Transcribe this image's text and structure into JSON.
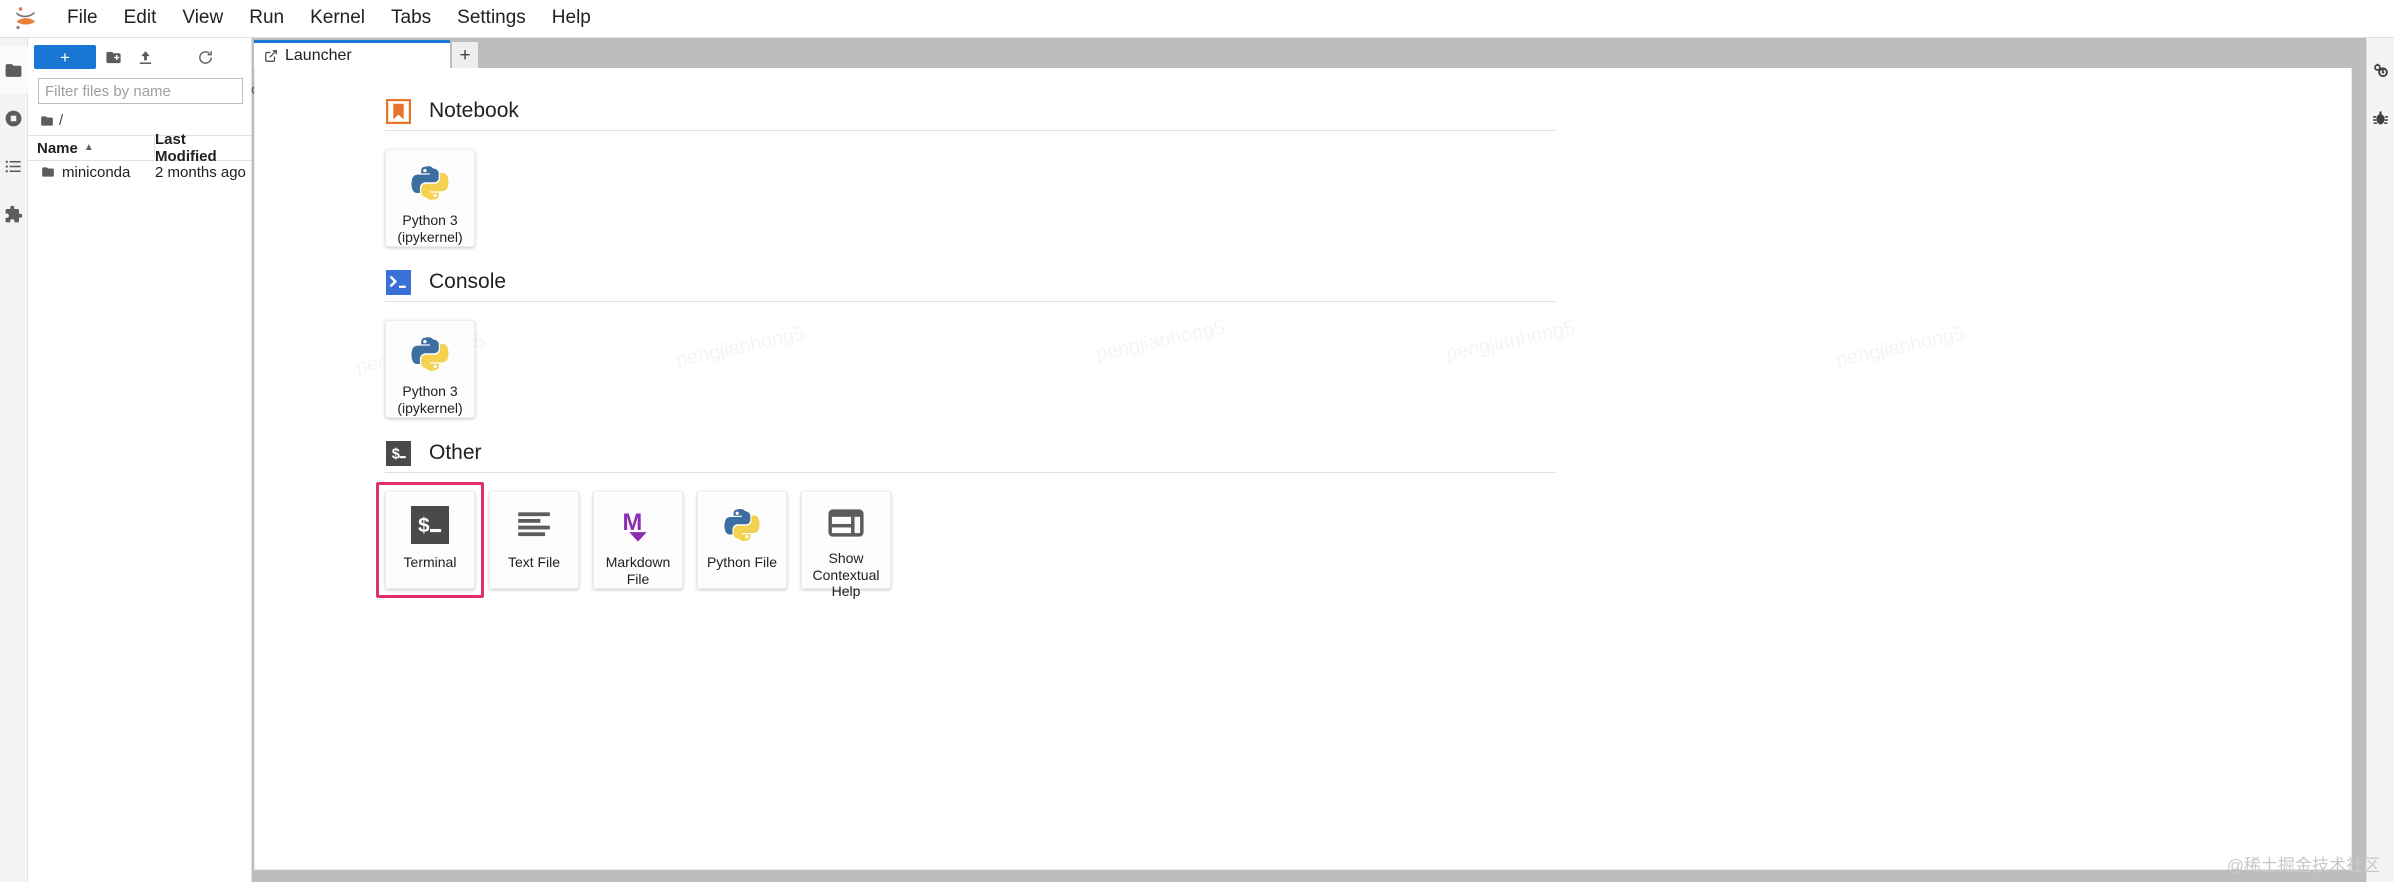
{
  "app": {
    "logo_icon": "jupyter-logo",
    "watermark": "@稀土掘金技术社区",
    "ghost_watermark": "pengjianhong5"
  },
  "menubar": {
    "items": [
      {
        "label": "File",
        "name": "menu-file"
      },
      {
        "label": "Edit",
        "name": "menu-edit"
      },
      {
        "label": "View",
        "name": "menu-view"
      },
      {
        "label": "Run",
        "name": "menu-run"
      },
      {
        "label": "Kernel",
        "name": "menu-kernel"
      },
      {
        "label": "Tabs",
        "name": "menu-tabs"
      },
      {
        "label": "Settings",
        "name": "menu-settings"
      },
      {
        "label": "Help",
        "name": "menu-help"
      }
    ]
  },
  "left_activity_bar": {
    "items": [
      {
        "name": "file-browser-icon",
        "icon": "folder-icon",
        "active": true
      },
      {
        "name": "running-sessions-icon",
        "icon": "stop-circle-icon",
        "active": false
      },
      {
        "name": "table-of-contents-icon",
        "icon": "list-icon",
        "active": false
      },
      {
        "name": "extension-manager-icon",
        "icon": "puzzle-icon",
        "active": false
      }
    ]
  },
  "right_activity_bar": {
    "items": [
      {
        "name": "property-inspector-icon",
        "icon": "gears-icon"
      },
      {
        "name": "debugger-icon",
        "icon": "bug-icon"
      }
    ]
  },
  "file_browser": {
    "toolbar": {
      "new_launcher_label": "+",
      "new_folder_icon": "new-folder-icon",
      "upload_icon": "upload-icon",
      "refresh_icon": "refresh-icon"
    },
    "filter": {
      "value": "",
      "placeholder": "Filter files by name",
      "search_icon": "search-icon"
    },
    "breadcrumb": {
      "root_icon": "folder-icon",
      "path": "/"
    },
    "columns": {
      "name": "Name",
      "last_modified": "Last Modified",
      "sort_caret": "▲"
    },
    "rows": [
      {
        "name": "miniconda",
        "last_modified": "2 months ago",
        "icon": "folder-icon"
      }
    ]
  },
  "main": {
    "tabs": [
      {
        "label": "Launcher",
        "icon": "launcher-icon",
        "active": true
      }
    ],
    "new_tab_label": "+"
  },
  "launcher": {
    "sections": [
      {
        "id": "notebook",
        "title": "Notebook",
        "icon": "notebook-bookmark-icon",
        "cards": [
          {
            "label": "Python 3\n(ipykernel)",
            "label_line1": "Python 3",
            "label_line2": "(ipykernel)",
            "icon": "python-icon",
            "name": "card-python3-notebook",
            "highlighted": false
          }
        ]
      },
      {
        "id": "console",
        "title": "Console",
        "icon": "console-prompt-icon",
        "cards": [
          {
            "label": "Python 3\n(ipykernel)",
            "label_line1": "Python 3",
            "label_line2": "(ipykernel)",
            "icon": "python-icon",
            "name": "card-python3-console",
            "highlighted": false
          }
        ]
      },
      {
        "id": "other",
        "title": "Other",
        "icon": "terminal-dollar-icon",
        "cards": [
          {
            "label": "Terminal",
            "label_line1": "Terminal",
            "label_line2": "",
            "icon": "terminal-dollar-icon",
            "name": "card-terminal",
            "highlighted": true
          },
          {
            "label": "Text File",
            "label_line1": "Text File",
            "label_line2": "",
            "icon": "text-file-icon",
            "name": "card-text-file",
            "highlighted": false
          },
          {
            "label": "Markdown File",
            "label_line1": "Markdown File",
            "label_line2": "",
            "icon": "markdown-icon",
            "name": "card-markdown-file",
            "highlighted": false
          },
          {
            "label": "Python File",
            "label_line1": "Python File",
            "label_line2": "",
            "icon": "python-icon",
            "name": "card-python-file",
            "highlighted": false
          },
          {
            "label": "Show Contextual Help",
            "label_line1": "Show",
            "label_line2": "Contextual Help",
            "icon": "contextual-help-icon",
            "name": "card-contextual-help",
            "highlighted": false
          }
        ]
      }
    ]
  },
  "colors": {
    "accent_blue": "#1976d2",
    "notebook_orange": "#e8732a",
    "console_blue": "#3a71d6",
    "other_dark": "#4a4a4a",
    "markdown_purple": "#8b2fb0",
    "highlight_pink": "#e0306b",
    "python_blue": "#3c6e9f",
    "python_yellow": "#f4d14f"
  }
}
